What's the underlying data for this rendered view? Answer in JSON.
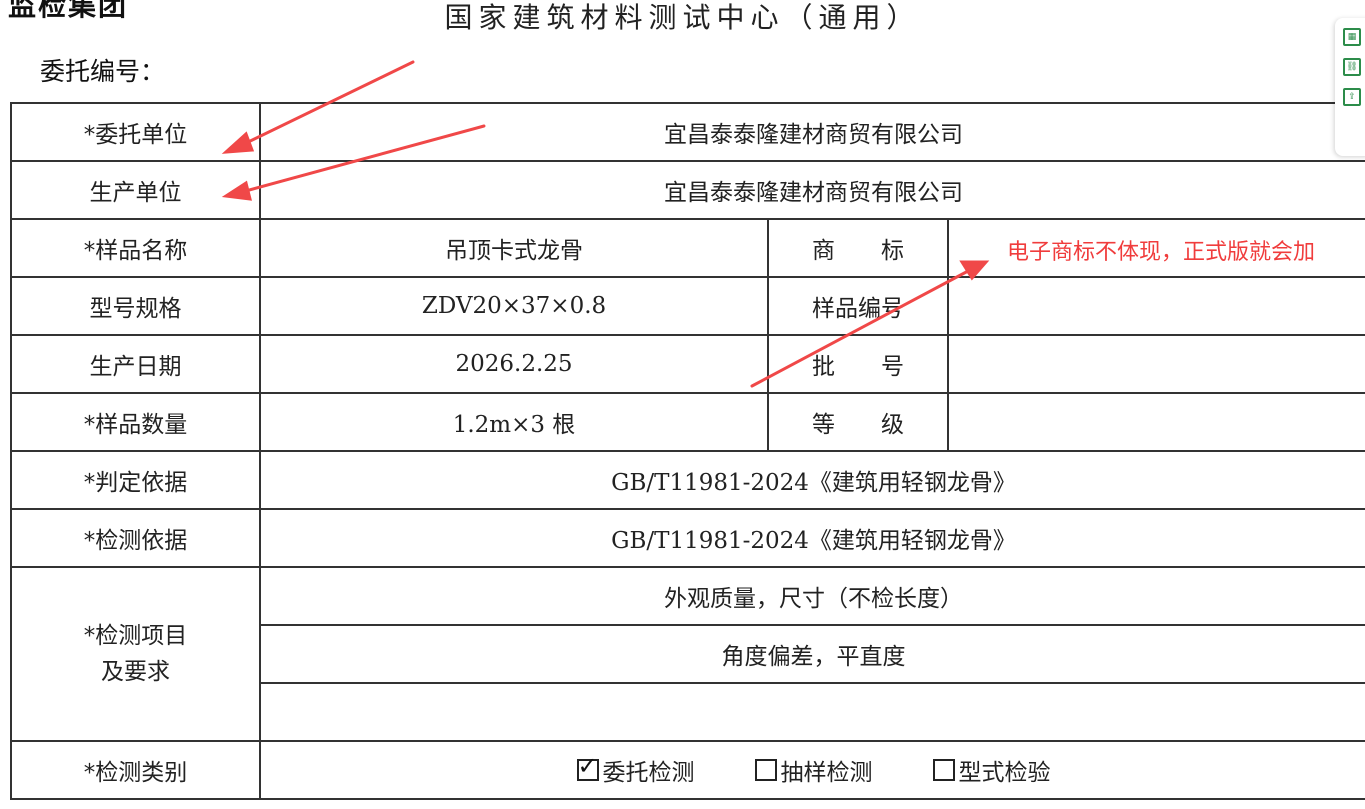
{
  "header": {
    "top_left_fragment": "监检集团",
    "title": "国家建筑材料测试中心（通用）",
    "commission_no_label": "委托编号："
  },
  "form": {
    "client_label": "*委托单位",
    "client_value": "宜昌泰泰隆建材商贸有限公司",
    "producer_label": "生产单位",
    "producer_value": "宜昌泰泰隆建材商贸有限公司",
    "sample_name_label": "*样品名称",
    "sample_name_value": "吊顶卡式龙骨",
    "trademark_label": "商　　标",
    "trademark_value": "",
    "model_label": "型号规格",
    "model_value": "ZDV20×37×0.8",
    "sample_no_label": "样品编号",
    "sample_no_value": "",
    "prod_date_label": "生产日期",
    "prod_date_value": "2026.2.25",
    "batch_label": "批　　号",
    "batch_value": "",
    "quantity_label": "*样品数量",
    "quantity_value": "1.2m×3 根",
    "grade_label": "等　　级",
    "grade_value": "",
    "judge_basis_label": "*判定依据",
    "judge_basis_value": "GB/T11981-2024《建筑用轻钢龙骨》",
    "test_basis_label": "*检测依据",
    "test_basis_value": "GB/T11981-2024《建筑用轻钢龙骨》",
    "items_label_line1": "*检测项目",
    "items_label_line2": "及要求",
    "items": [
      "外观质量，尺寸（不检长度）",
      "角度偏差，平直度",
      ""
    ],
    "category_label": "*检测类别",
    "categories": [
      {
        "label": "委托检测",
        "checked": true
      },
      {
        "label": "抽样检测",
        "checked": false
      },
      {
        "label": "型式检验",
        "checked": false
      }
    ]
  },
  "annotation": {
    "text": "电子商标不体现，正式版就会加",
    "color": "#f03c3c"
  },
  "sidebar": {
    "icons": [
      "table-icon",
      "link-icon",
      "share-icon"
    ],
    "accent": "#2c8c4a"
  }
}
